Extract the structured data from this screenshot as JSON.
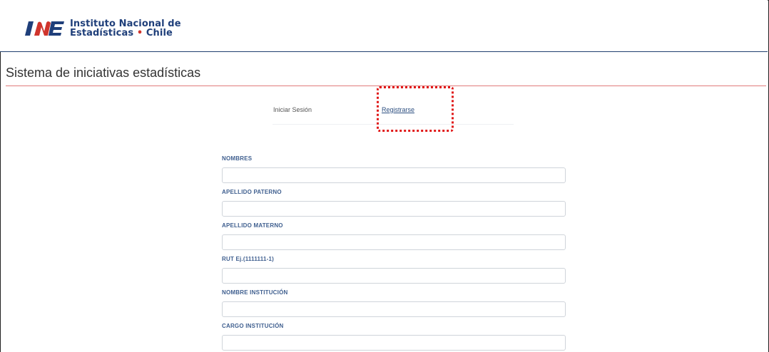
{
  "header": {
    "logo_line1": "Instituto Nacional de",
    "logo_line2a": "Estadísticas",
    "logo_separator": "•",
    "logo_line2b": "Chile",
    "brand_blue": "#1f3f7a",
    "brand_red": "#d0342c"
  },
  "page": {
    "title": "Sistema de iniciativas estadísticas"
  },
  "tabs": {
    "login_label": "Iniciar Sesión",
    "register_label": "Registrarse"
  },
  "form": {
    "fields": [
      {
        "label": "NOMBRES",
        "value": ""
      },
      {
        "label": "APELLIDO PATERNO",
        "value": ""
      },
      {
        "label": "APELLIDO MATERNO",
        "value": ""
      },
      {
        "label": "RUT Ej.(1111111-1)",
        "value": ""
      },
      {
        "label": "NOMBRE INSTITUCIÓN",
        "value": ""
      },
      {
        "label": "CARGO INSTITUCIÓN",
        "value": ""
      }
    ]
  },
  "annotation": {
    "highlight_color": "#e01818"
  }
}
